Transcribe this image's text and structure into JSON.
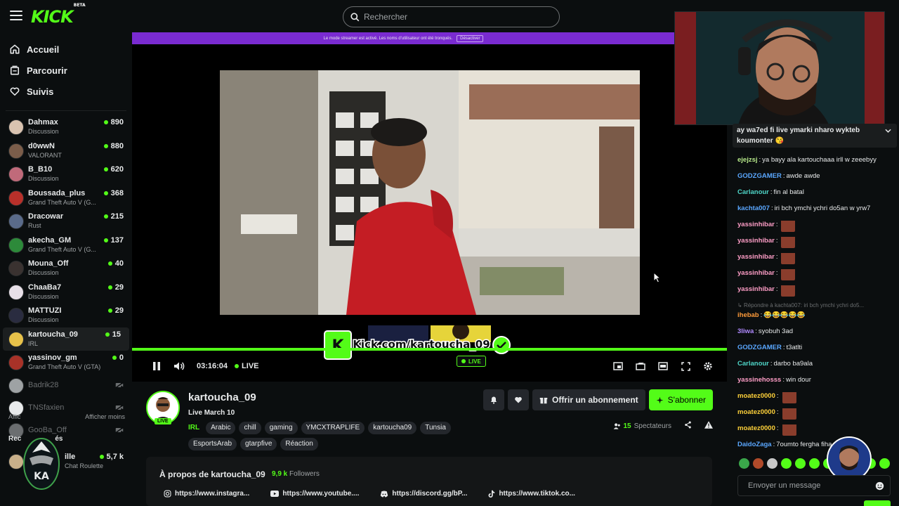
{
  "app": {
    "logo": "KICK",
    "logo_badge": "BETA"
  },
  "search": {
    "placeholder": "Rechercher"
  },
  "nav": [
    {
      "label": "Accueil",
      "icon": "home-icon"
    },
    {
      "label": "Parcourir",
      "icon": "browse-icon"
    },
    {
      "label": "Suivis",
      "icon": "heart-icon"
    }
  ],
  "followed": [
    {
      "name": "Dahmax",
      "category": "Discussion",
      "viewers": "890",
      "avatar_color": "#d9c3b0"
    },
    {
      "name": "d0wwN",
      "category": "VALORANT",
      "viewers": "880",
      "avatar_color": "#7b5d4a"
    },
    {
      "name": "B_B10",
      "category": "Discussion",
      "viewers": "620",
      "avatar_color": "#c06a7a"
    },
    {
      "name": "Boussada_plus",
      "category": "Grand Theft Auto V (G...",
      "viewers": "368",
      "avatar_color": "#b8302a"
    },
    {
      "name": "Dracowar",
      "category": "Rust",
      "viewers": "215",
      "avatar_color": "#5a6b8a"
    },
    {
      "name": "akecha_GM",
      "category": "Grand Theft Auto V (G...",
      "viewers": "137",
      "avatar_color": "#2d8a3a"
    },
    {
      "name": "Mouna_Off",
      "category": "Discussion",
      "viewers": "40",
      "avatar_color": "#3a3230"
    },
    {
      "name": "ChaaBa7",
      "category": "Discussion",
      "viewers": "29",
      "avatar_color": "#e8e0e8"
    },
    {
      "name": "MATTUZI",
      "category": "Discussion",
      "viewers": "29",
      "avatar_color": "#2a2c40"
    },
    {
      "name": "kartoucha_09",
      "category": "IRL",
      "viewers": "15",
      "avatar_color": "#e8c24a"
    },
    {
      "name": "yassinov_gm",
      "category": "Grand Theft Auto V (GTA)",
      "viewers": "0",
      "avatar_color": "#a83228"
    }
  ],
  "offline": [
    {
      "name": "Badrik28",
      "avatar_color": "#9ea2a4"
    },
    {
      "name": "TNSfaxien",
      "avatar_color": "#e8eaeb"
    },
    {
      "name": "GooBa_Off",
      "avatar_color": "#6b6e70"
    }
  ],
  "sidebar_footer": {
    "show_all": "Affic",
    "show_less": "Afficher moins"
  },
  "recommended": {
    "title": "Rec",
    "title_suffix": "és",
    "name": "ille",
    "category": "Chat Roulette",
    "viewers": "5,7 k"
  },
  "clan_logo_text": "KA",
  "banner": {
    "text": "Le mode streamer est activé. Les noms d'utilisateur ont été tronqués.",
    "button": "Désactiver"
  },
  "player": {
    "time": "03:16:04",
    "live_label": "LIVE",
    "overlay_url": "Kick.com/kartoucha_09",
    "overlay_live": "LIVE"
  },
  "stream": {
    "name": "kartoucha_09",
    "title": "Live March 10",
    "live_badge": "LIVE",
    "category": "IRL",
    "tags": [
      "Arabic",
      "chill",
      "gaming",
      "YMCXTRAPLIFE",
      "kartoucha09",
      "Tunsia",
      "EsportsArab",
      "gtarpfive",
      "Réaction"
    ],
    "viewers": "15",
    "viewers_label": "Spectateurs",
    "gift_label": "Offrir un abonnement",
    "subscribe_label": "S'abonner"
  },
  "about": {
    "title": "À propos de kartoucha_09",
    "followers_count": "9,9 k",
    "followers_label": "Followers",
    "links": [
      {
        "icon": "instagram-icon",
        "text": "https://www.instagra..."
      },
      {
        "icon": "youtube-icon",
        "text": "https://www.youtube...."
      },
      {
        "icon": "discord-icon",
        "text": "https://discord.gg/bP..."
      },
      {
        "icon": "tiktok-icon",
        "text": "https://www.tiktok.co..."
      }
    ]
  },
  "chat": {
    "pinned": "ay wa7ed fi live ymarki nharo wykteb koumonter 😘",
    "messages": [
      {
        "user": "ejejzsj",
        "color": "#b6e88a",
        "text": "ya bayy ala kartouchaaa irll w zeeebyy"
      },
      {
        "user": "GODZGAMER",
        "color": "#5aa7ff",
        "text": "awde awde"
      },
      {
        "user": "Carlanour",
        "color": "#4fd6c8",
        "text": "fin al batal"
      },
      {
        "user": "kachta007",
        "color": "#5aa7ff",
        "text": "iri bch ymchi ychri do5an w yrw7"
      },
      {
        "user": "yassinhibar",
        "color": "#ff9ec7",
        "text": "",
        "emote": true
      },
      {
        "user": "yassinhibar",
        "color": "#ff9ec7",
        "text": "",
        "emote": true
      },
      {
        "user": "yassinhibar",
        "color": "#ff9ec7",
        "text": "",
        "emote": true
      },
      {
        "user": "yassinhibar",
        "color": "#ff9ec7",
        "text": "",
        "emote": true
      },
      {
        "user": "yassinhibar",
        "color": "#ff9ec7",
        "text": "",
        "emote": true
      }
    ],
    "reply": "Répondre à kachta007: iri bch ymchi ychri do5...",
    "messages2": [
      {
        "user": "ihebab",
        "color": "#ff9b3a",
        "text": "😂😂😂😂😂"
      },
      {
        "user": "3liwa",
        "color": "#b08aff",
        "text": "syobuh 3ad"
      },
      {
        "user": "GODZGAMER",
        "color": "#5aa7ff",
        "text": "t3atlti"
      },
      {
        "user": "Carlanour",
        "color": "#4fd6c8",
        "text": "darbo ba9ala"
      },
      {
        "user": "yassinehosss",
        "color": "#ff9ec7",
        "text": "win dour"
      },
      {
        "user": "moatez0000",
        "color": "#ffd23a",
        "text": "",
        "emote": true
      },
      {
        "user": "moatez0000",
        "color": "#ffd23a",
        "text": "",
        "emote": true
      },
      {
        "user": "moatez0000",
        "color": "#ffd23a",
        "text": "",
        "emote": true
      },
      {
        "user": "DaidoZaga",
        "color": "#5aa7ff",
        "text": "7oumto fergha fiha ...ewa"
      }
    ],
    "placeholder": "Envoyer un message",
    "overlay_name": "3liwa"
  },
  "colors": {
    "accent": "#53fc18",
    "banner": "#7a2bd1",
    "bg": "#0b0e0f",
    "panel": "#141617",
    "chip": "#24272c"
  }
}
